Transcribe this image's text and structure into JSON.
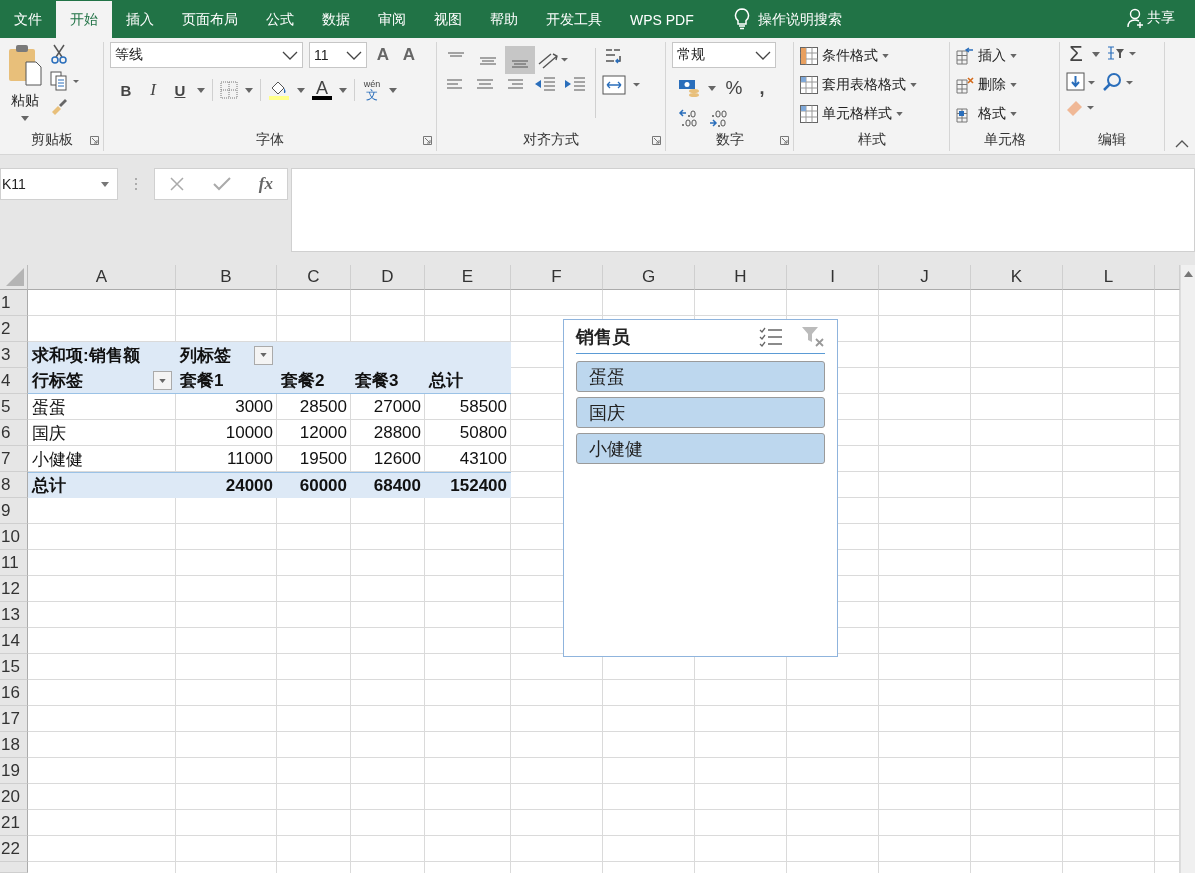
{
  "tabs": [
    {
      "label": "文件",
      "selected": false
    },
    {
      "label": "开始",
      "selected": true
    },
    {
      "label": "插入",
      "selected": false
    },
    {
      "label": "页面布局",
      "selected": false
    },
    {
      "label": "公式",
      "selected": false
    },
    {
      "label": "数据",
      "selected": false
    },
    {
      "label": "审阅",
      "selected": false
    },
    {
      "label": "视图",
      "selected": false
    },
    {
      "label": "帮助",
      "selected": false
    },
    {
      "label": "开发工具",
      "selected": false
    },
    {
      "label": "WPS PDF",
      "selected": false
    }
  ],
  "tell_me": "操作说明搜索",
  "share": "共享",
  "ribbon": {
    "clipboard": {
      "paste": "粘贴",
      "label": "剪贴板"
    },
    "font": {
      "name": "等线",
      "size": "11",
      "grow": "A",
      "shrink": "A",
      "bold": "B",
      "italic": "I",
      "underline": "U",
      "font_color": "A",
      "phonetic": "wén",
      "phonetic_char": "文",
      "label": "字体"
    },
    "alignment": {
      "vertical": [
        {
          "selected": false
        },
        {
          "selected": false
        },
        {
          "selected": true
        }
      ],
      "label": "对齐方式"
    },
    "number": {
      "format": "常规",
      "percent": "%",
      "comma": ",",
      "label": "数字"
    },
    "styles": {
      "items": [
        "条件格式",
        "套用表格格式",
        "单元格样式"
      ],
      "label": "样式"
    },
    "cells": {
      "items": [
        "插入",
        "删除",
        "格式"
      ],
      "label": "单元格"
    },
    "editing": {
      "sum": "Σ",
      "label": "编辑"
    }
  },
  "formula_bar": {
    "name_box": "K11",
    "function_button": "fx"
  },
  "sheet": {
    "columns": [
      "A",
      "B",
      "C",
      "D",
      "E",
      "F",
      "G",
      "H",
      "I",
      "J",
      "K",
      "L"
    ],
    "rows": [
      "1",
      "2",
      "3",
      "4",
      "5",
      "6",
      "7",
      "8",
      "9",
      "10",
      "11",
      "12",
      "13",
      "14",
      "15",
      "16",
      "17",
      "18",
      "19",
      "20",
      "21",
      "22"
    ]
  },
  "pivot": {
    "value_field": "求和项:销售额",
    "column_label": "列标签",
    "row_label": "行标签",
    "columns": [
      "套餐1",
      "套餐2",
      "套餐3",
      "总计"
    ],
    "rows": [
      {
        "name": "蛋蛋",
        "values": [
          "3000",
          "28500",
          "27000",
          "58500"
        ]
      },
      {
        "name": "国庆",
        "values": [
          "10000",
          "12000",
          "28800",
          "50800"
        ]
      },
      {
        "name": "小健健",
        "values": [
          "11000",
          "19500",
          "12600",
          "43100"
        ]
      }
    ],
    "total": {
      "name": "总计",
      "values": [
        "24000",
        "60000",
        "68400",
        "152400"
      ]
    }
  },
  "slicer": {
    "title": "销售员",
    "items": [
      {
        "label": "蛋蛋",
        "selected": true
      },
      {
        "label": "国庆",
        "selected": true
      },
      {
        "label": "小健健",
        "selected": true
      }
    ]
  }
}
